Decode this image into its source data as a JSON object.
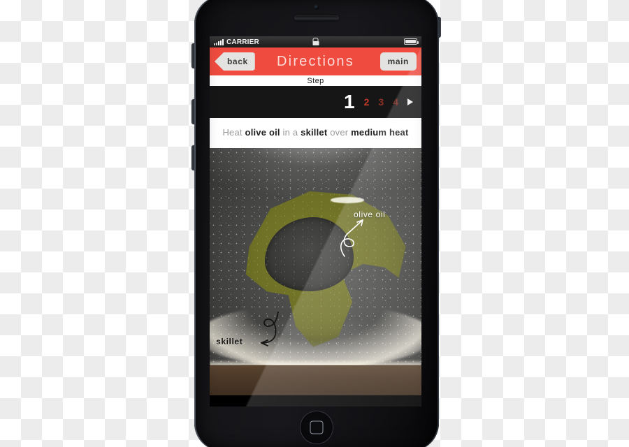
{
  "app": {
    "title": "Directions"
  },
  "status_bar": {
    "carrier": "CARRIER",
    "signal_icon": "signal-bars-icon",
    "lock_icon": "lock-icon",
    "battery_icon": "battery-icon"
  },
  "nav_bar": {
    "back_label": "back",
    "title": "Directions",
    "main_label": "main",
    "accent_color": "#ef4b3f",
    "button_bg": "#e3e3e1"
  },
  "step_nav": {
    "label": "Step",
    "steps": [
      {
        "number": "1",
        "active": true
      },
      {
        "number": "2",
        "active": false
      },
      {
        "number": "3",
        "active": false
      },
      {
        "number": "4",
        "active": false
      }
    ],
    "next_arrow_icon": "play-arrow-icon",
    "active_color": "#ffffff",
    "inactive_color": "#b7382c"
  },
  "instruction": {
    "part1": "Heat ",
    "bold1": "olive oil",
    "part2": " in a ",
    "bold2": "skillet",
    "part3": " over ",
    "bold3": "medium heat"
  },
  "photo": {
    "annotations": [
      {
        "label": "olive oil",
        "color": "#ffffff"
      },
      {
        "label": "skillet",
        "color": "#141414"
      }
    ]
  },
  "device": {
    "earpiece_icon": "earpiece-speaker-icon",
    "camera_icon": "front-camera-icon",
    "home_button_icon": "home-button-icon",
    "mute_switch_icon": "mute-switch-icon",
    "volume_up_icon": "volume-up-button-icon",
    "volume_down_icon": "volume-down-button-icon",
    "power_icon": "power-button-icon"
  }
}
